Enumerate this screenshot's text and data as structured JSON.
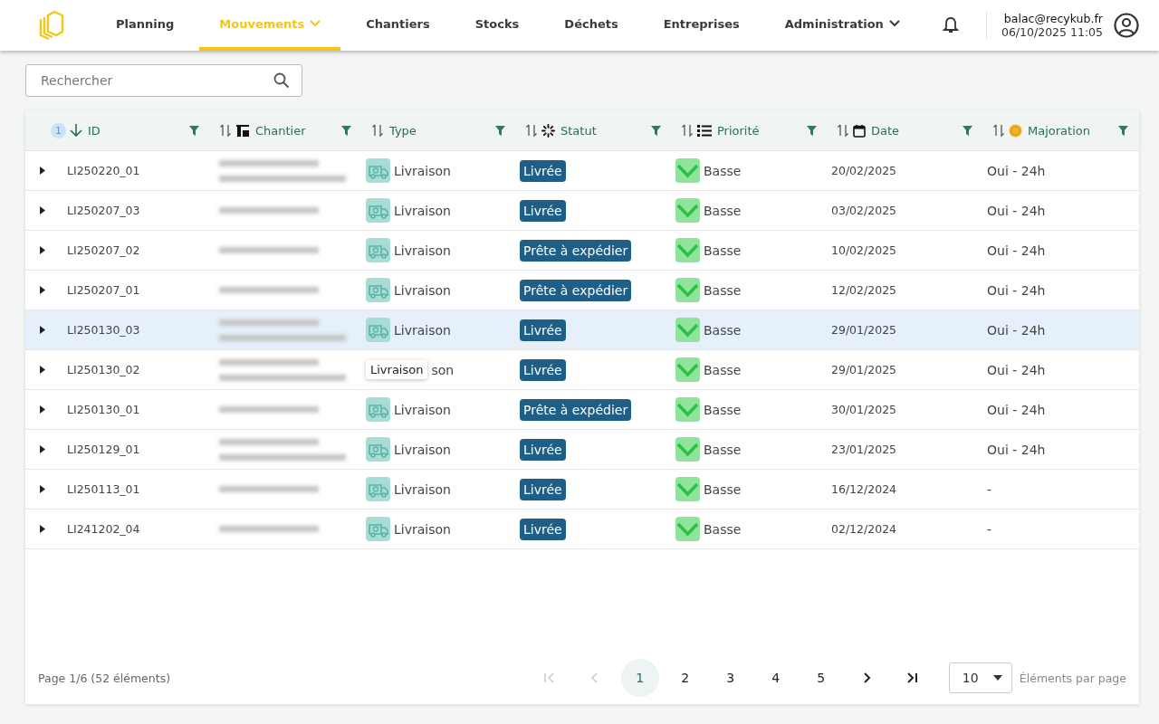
{
  "nav": {
    "items": [
      {
        "label": "Planning",
        "selected": false,
        "dropdown": false
      },
      {
        "label": "Mouvements",
        "selected": true,
        "dropdown": true
      },
      {
        "label": "Chantiers",
        "selected": false,
        "dropdown": false
      },
      {
        "label": "Stocks",
        "selected": false,
        "dropdown": false
      },
      {
        "label": "Déchets",
        "selected": false,
        "dropdown": false
      },
      {
        "label": "Entreprises",
        "selected": false,
        "dropdown": false
      },
      {
        "label": "Administration",
        "selected": false,
        "dropdown": true
      }
    ],
    "user": {
      "email": "balac@recykub.fr",
      "datetime": "06/10/2025 11:05"
    }
  },
  "search": {
    "placeholder": "Rechercher"
  },
  "table": {
    "columns": [
      {
        "label": "ID",
        "sorted": true,
        "sort_order": "1"
      },
      {
        "label": "Chantier",
        "sorted": false
      },
      {
        "label": "Type",
        "sorted": false
      },
      {
        "label": "Statut",
        "sorted": false
      },
      {
        "label": "Priorité",
        "sorted": false
      },
      {
        "label": "Date",
        "sorted": false
      },
      {
        "label": "Majoration",
        "sorted": false
      }
    ],
    "rows": [
      {
        "id": "LI250220_01",
        "chantier_two_lines": true,
        "type": "Livraison",
        "statut": "Livrée",
        "priorite": "Basse",
        "date": "20/02/2025",
        "majoration": "Oui - 24h",
        "highlighted": false
      },
      {
        "id": "LI250207_03",
        "chantier_two_lines": false,
        "type": "Livraison",
        "statut": "Livrée",
        "priorite": "Basse",
        "date": "03/02/2025",
        "majoration": "Oui - 24h",
        "highlighted": false
      },
      {
        "id": "LI250207_02",
        "chantier_two_lines": false,
        "type": "Livraison",
        "statut": "Prête à expédier",
        "priorite": "Basse",
        "date": "10/02/2025",
        "majoration": "Oui - 24h",
        "highlighted": false
      },
      {
        "id": "LI250207_01",
        "chantier_two_lines": false,
        "type": "Livraison",
        "statut": "Prête à expédier",
        "priorite": "Basse",
        "date": "12/02/2025",
        "majoration": "Oui - 24h",
        "highlighted": false
      },
      {
        "id": "LI250130_03",
        "chantier_two_lines": true,
        "type": "Livraison",
        "statut": "Livrée",
        "priorite": "Basse",
        "date": "29/01/2025",
        "majoration": "Oui - 24h",
        "highlighted": true
      },
      {
        "id": "LI250130_02",
        "chantier_two_lines": true,
        "type": "son",
        "type_tooltip": "Livraison",
        "statut": "Livrée",
        "priorite": "Basse",
        "date": "29/01/2025",
        "majoration": "Oui - 24h",
        "highlighted": false
      },
      {
        "id": "LI250130_01",
        "chantier_two_lines": false,
        "type": "Livraison",
        "statut": "Prête à expédier",
        "priorite": "Basse",
        "date": "30/01/2025",
        "majoration": "Oui - 24h",
        "highlighted": false
      },
      {
        "id": "LI250129_01",
        "chantier_two_lines": true,
        "type": "Livraison",
        "statut": "Livrée",
        "priorite": "Basse",
        "date": "23/01/2025",
        "majoration": "Oui - 24h",
        "highlighted": false
      },
      {
        "id": "LI250113_01",
        "chantier_two_lines": false,
        "type": "Livraison",
        "statut": "Livrée",
        "priorite": "Basse",
        "date": "16/12/2024",
        "majoration": "-",
        "highlighted": false
      },
      {
        "id": "LI241202_04",
        "chantier_two_lines": false,
        "type": "Livraison",
        "statut": "Livrée",
        "priorite": "Basse",
        "date": "02/12/2024",
        "majoration": "-",
        "highlighted": false
      }
    ]
  },
  "pagination": {
    "summary": "Page 1/6 (52 éléments)",
    "first_disabled": true,
    "prev_disabled": true,
    "next_disabled": false,
    "last_disabled": false,
    "pages": [
      {
        "label": "1",
        "selected": true
      },
      {
        "label": "2",
        "selected": false
      },
      {
        "label": "3",
        "selected": false
      },
      {
        "label": "4",
        "selected": false
      },
      {
        "label": "5",
        "selected": false
      }
    ],
    "page_size": "10",
    "page_size_label": "Éléments par page"
  }
}
